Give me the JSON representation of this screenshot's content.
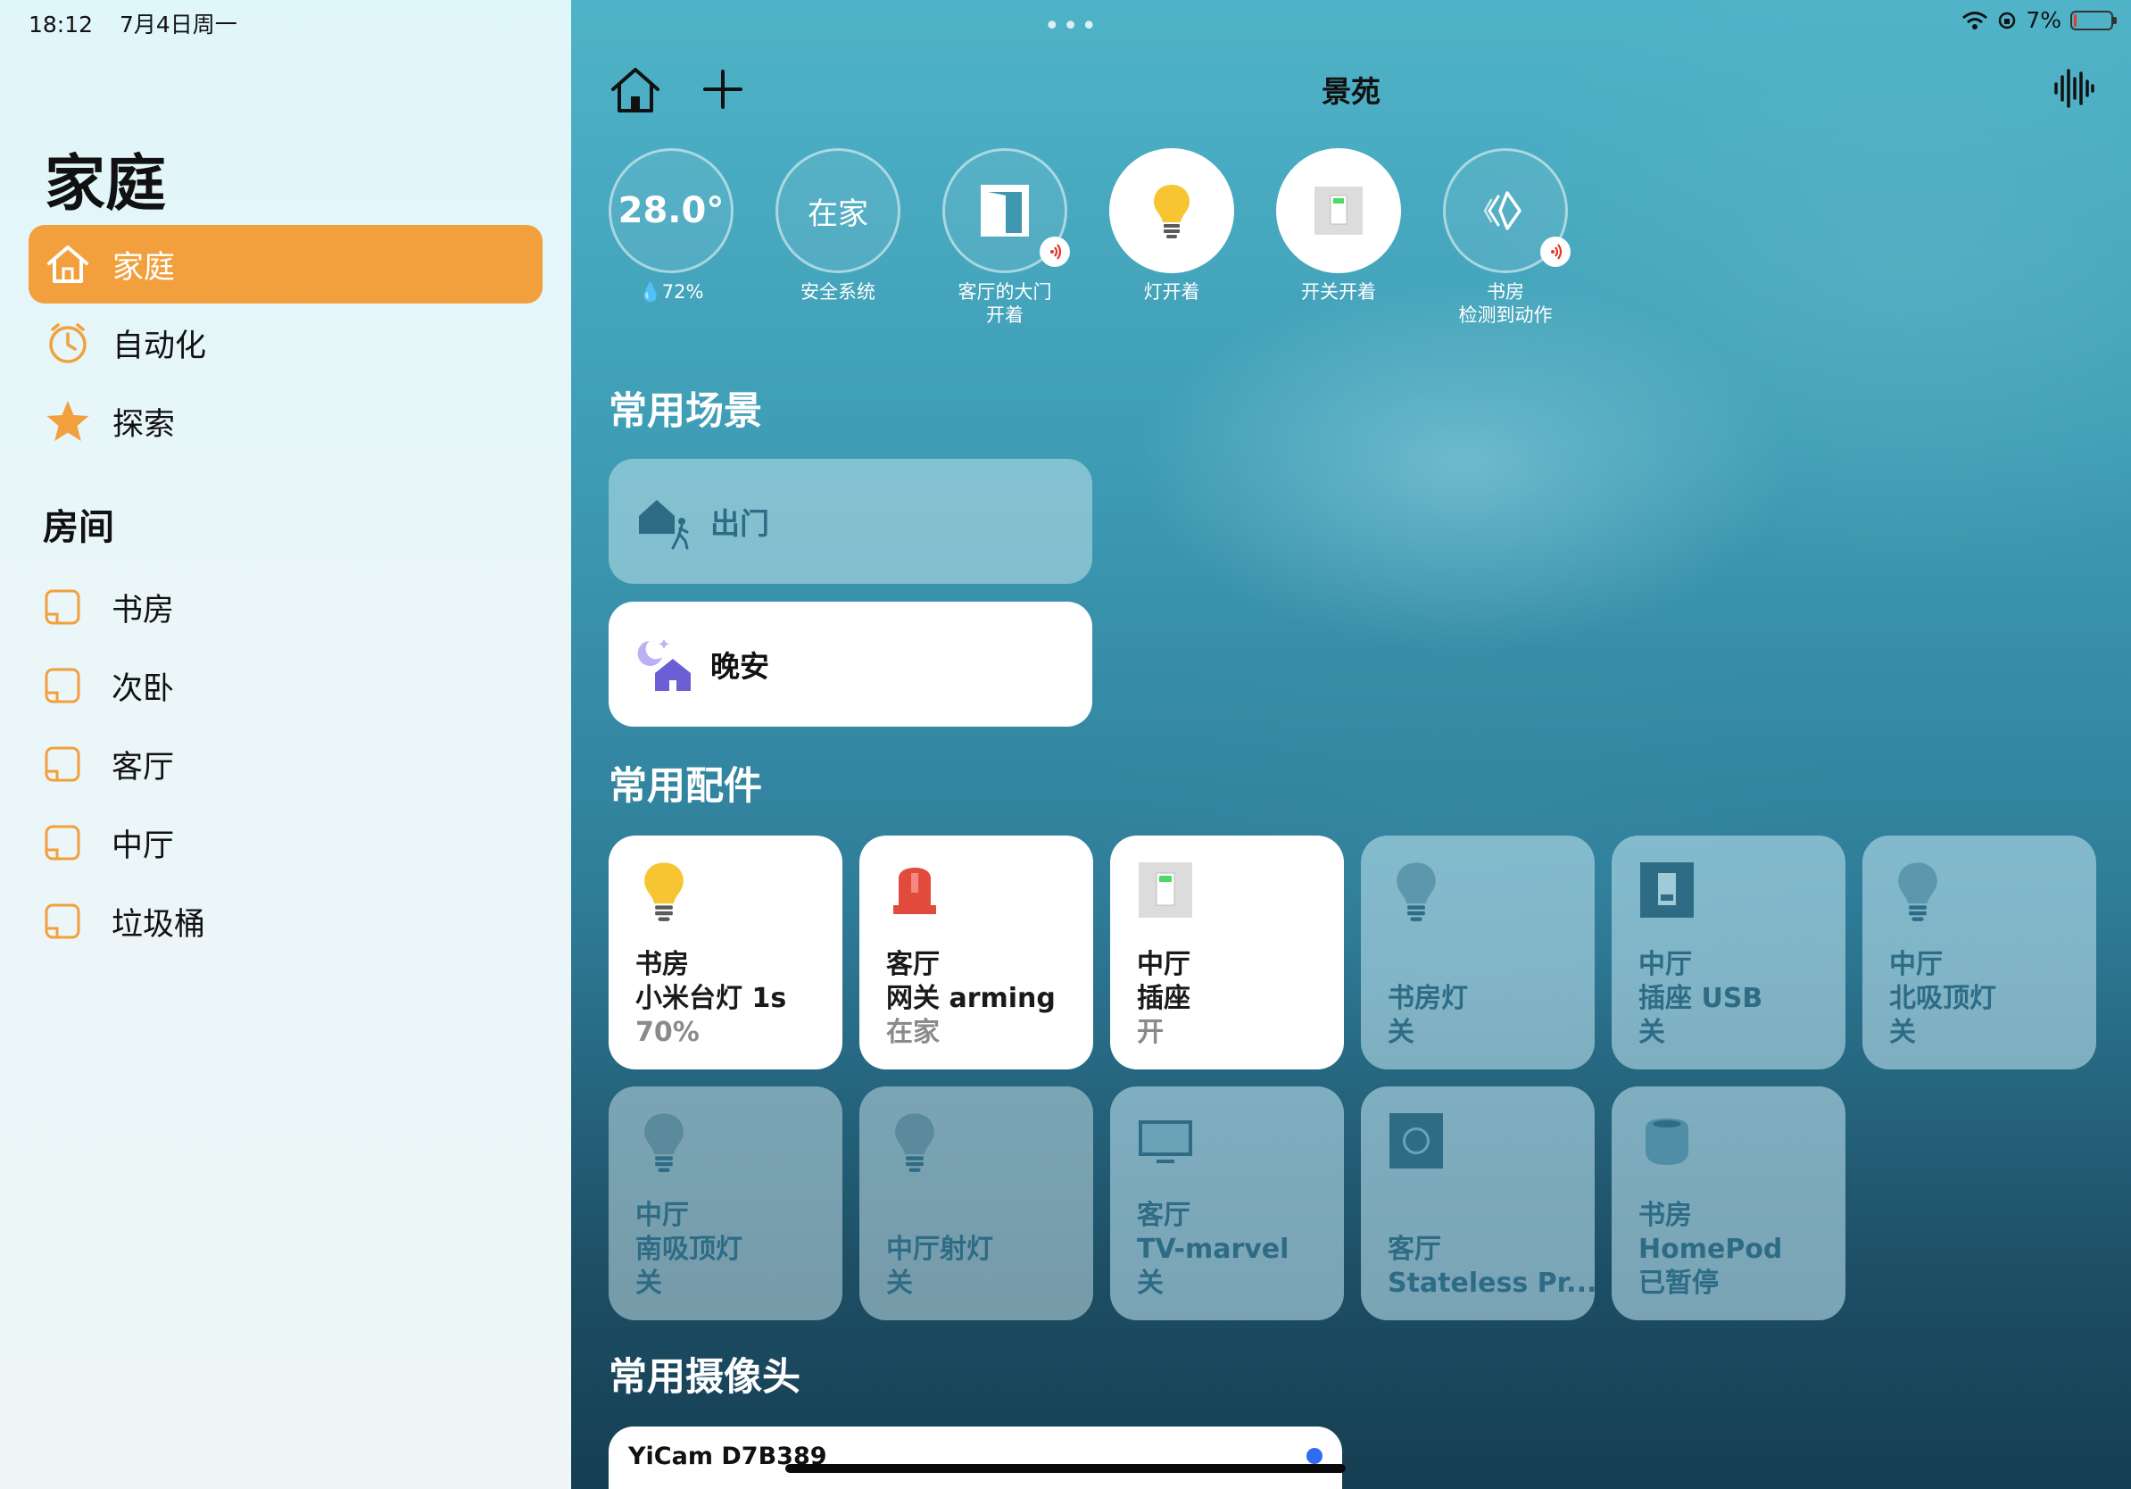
{
  "status_bar": {
    "time": "18:12",
    "date": "7月4日周一",
    "battery": "7%",
    "battery_level": 0.07
  },
  "sidebar": {
    "title": "家庭",
    "nav": [
      {
        "label": "家庭",
        "icon": "house-icon",
        "active": true
      },
      {
        "label": "自动化",
        "icon": "clock-icon",
        "active": false
      },
      {
        "label": "探索",
        "icon": "star-icon",
        "active": false
      }
    ],
    "rooms_title": "房间",
    "rooms": [
      {
        "label": "书房"
      },
      {
        "label": "次卧"
      },
      {
        "label": "客厅"
      },
      {
        "label": "中厅"
      },
      {
        "label": "垃圾桶"
      }
    ]
  },
  "header": {
    "title": "景苑"
  },
  "status_items": [
    {
      "value": "28.0°",
      "caption": "💧72%"
    },
    {
      "value": "在家",
      "caption": "安全系统"
    },
    {
      "caption": "客厅的大门\n开着",
      "icon": "door-icon",
      "alert": true
    },
    {
      "caption": "灯开着",
      "icon": "bulb-icon"
    },
    {
      "caption": "开关开着",
      "icon": "switch-icon"
    },
    {
      "caption": "书房\n检测到动作",
      "icon": "motion-icon",
      "alert": true
    }
  ],
  "scenes_title": "常用场景",
  "scenes": [
    {
      "label": "出门",
      "icon": "leave-home-icon",
      "active": false
    },
    {
      "label": "晚安",
      "icon": "good-night-icon",
      "active": true
    }
  ],
  "accessories_title": "常用配件",
  "accessories": [
    {
      "room": "书房",
      "name": "小米台灯 1s",
      "status": "70%",
      "icon": "bulb-icon",
      "on": true
    },
    {
      "room": "客厅",
      "name": "网关 arming",
      "status": "在家",
      "icon": "alarm-icon",
      "on": true
    },
    {
      "room": "中厅",
      "name": "插座",
      "status": "开",
      "icon": "switch-icon",
      "on": true
    },
    {
      "room": "",
      "name": "书房灯",
      "status": "关",
      "icon": "bulb-icon",
      "on": false
    },
    {
      "room": "中厅",
      "name": "插座 USB",
      "status": "关",
      "icon": "switch-icon",
      "on": false
    },
    {
      "room": "中厅",
      "name": "北吸顶灯",
      "status": "关",
      "icon": "bulb-icon",
      "on": false
    },
    {
      "room": "中厅",
      "name": "南吸顶灯",
      "status": "关",
      "icon": "bulb-icon",
      "on": false
    },
    {
      "room": "",
      "name": "中厅射灯",
      "status": "关",
      "icon": "bulb-icon",
      "on": false
    },
    {
      "room": "客厅",
      "name": "TV-marvel",
      "status": "关",
      "icon": "tv-icon",
      "on": false
    },
    {
      "room": "客厅",
      "name": "Stateless Pr...",
      "status": "",
      "icon": "speaker-icon",
      "on": false
    },
    {
      "room": "书房",
      "name": "HomePod",
      "status": "已暂停",
      "icon": "homepod-icon",
      "on": false
    }
  ],
  "cameras_title": "常用摄像头",
  "cameras": [
    {
      "name": "YiCam D7B389"
    }
  ],
  "colors": {
    "accent": "#f2a03d",
    "bulb_on": "#f7c531",
    "alarm": "#e24a3b",
    "alert_red": "#e0342b",
    "off_text": "#2e6c86"
  }
}
